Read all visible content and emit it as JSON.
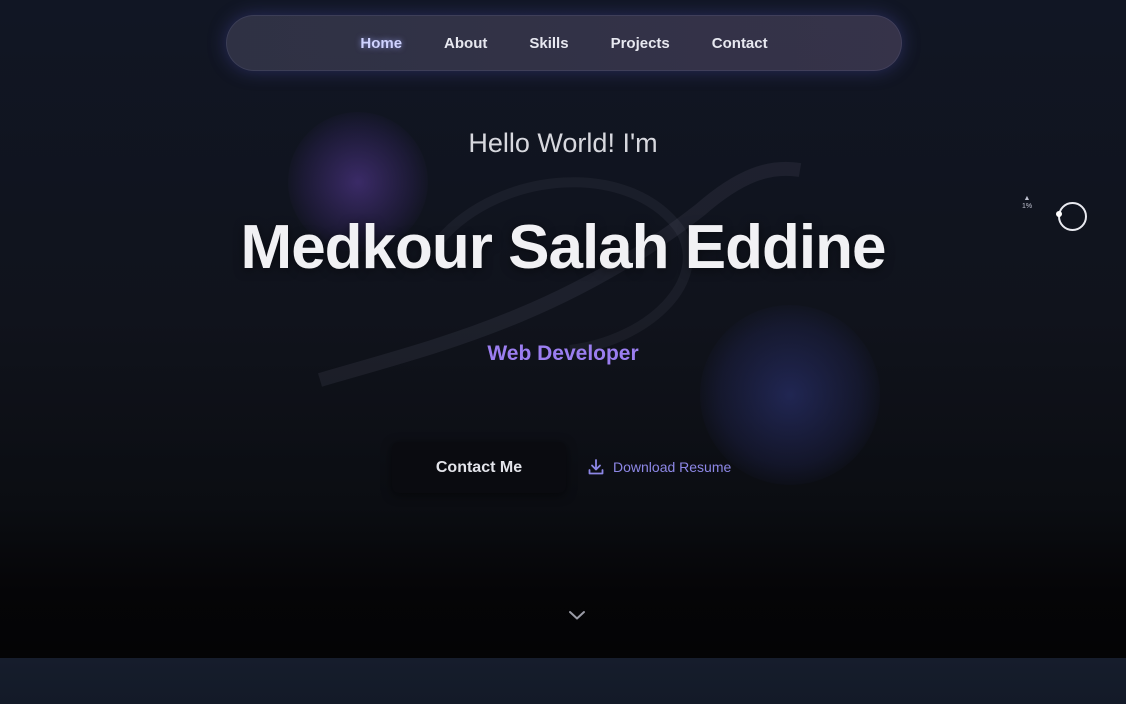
{
  "nav": {
    "items": [
      {
        "label": "Home",
        "active": true
      },
      {
        "label": "About"
      },
      {
        "label": "Skills"
      },
      {
        "label": "Projects"
      },
      {
        "label": "Contact"
      }
    ]
  },
  "hero": {
    "greeting": "Hello World! I'm",
    "name": "Medkour Salah Eddine",
    "role": "Web Developer",
    "contact_button": "Contact Me",
    "download_button": "Download Resume",
    "download_icon": "download-icon",
    "scroll_icon": "chevron-down-icon"
  },
  "widget": {
    "percent": "1%"
  },
  "colors": {
    "accent": "#9b7ef0",
    "link": "#8d87e6",
    "background": "#10131c"
  }
}
